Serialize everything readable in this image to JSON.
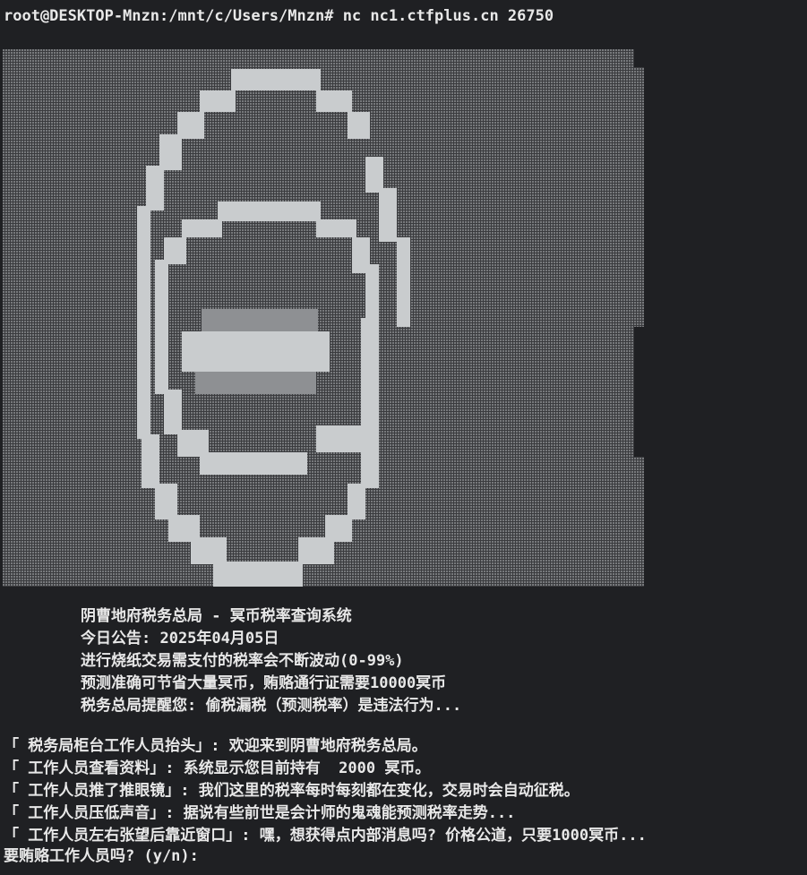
{
  "terminal": {
    "command_line": "root@DESKTOP-Mnzn:/mnt/c/Users/Mnzn# nc nc1.ctfplus.cn 26750",
    "colors": {
      "background": "#1f2023",
      "art_dark": "#5c5e61",
      "art_mid": "#8e9093",
      "art_light": "#c9ccce",
      "text": "#e8e8e8"
    },
    "banner": [
      "阴曹地府税务总局 - 冥币税率查询系统",
      "今日公告: 2025年04月05日",
      "进行烧纸交易需支付的税率会不断波动(0-99%)",
      "预测准确可节省大量冥币，贿赂通行证需要10000冥币",
      "税务总局提醒您: 偷税漏税（预测税率）是违法行为..."
    ],
    "dialogue": [
      "「 税务局柜台工作人员抬头」: 欢迎来到阴曹地府税务总局。",
      "「 工作人员查看资料」: 系统显示您目前持有  2000 冥币。",
      "「 工作人员推了推眼镜」: 我们这里的税率每时每刻都在变化，交易时会自动征税。",
      "「 工作人员压低声音」: 据说有些前世是会计师的鬼魂能预测税率走势...",
      "「 工作人员左右张望后靠近窗口」: 嘿，想获得点内部消息吗? 价格公道，只要1000冥币..."
    ],
    "input_prompt": "要贿赂工作人员吗? (y/n):"
  }
}
